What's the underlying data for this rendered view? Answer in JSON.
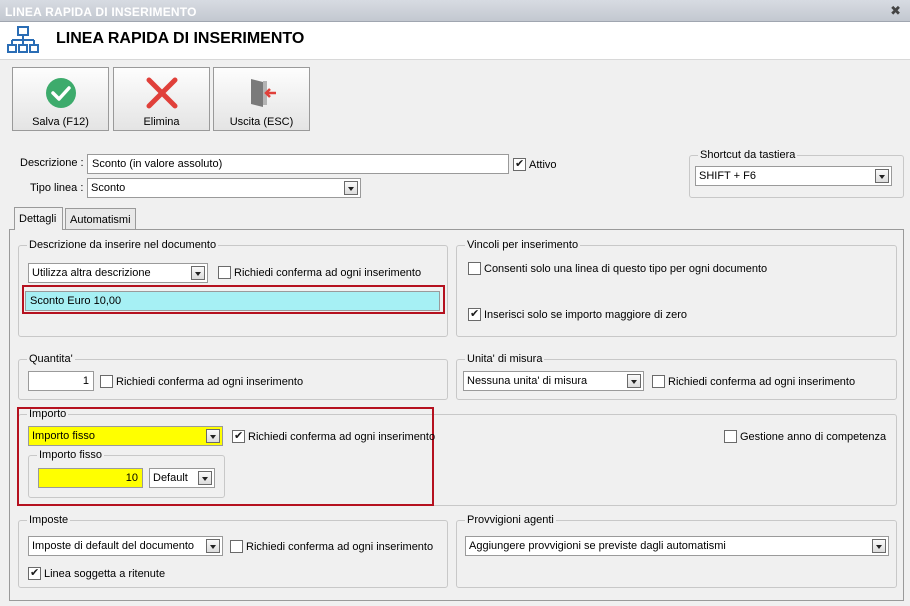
{
  "window": {
    "title": "LINEA RAPIDA DI INSERIMENTO",
    "header_title": "LINEA RAPIDA DI INSERIMENTO"
  },
  "toolbar": {
    "save_label": "Salva (F12)",
    "delete_label": "Elimina",
    "exit_label": "Uscita (ESC)"
  },
  "form": {
    "descrizione_label": "Descrizione :",
    "descrizione_value": "Sconto (in valore assoluto)",
    "attivo_label": "Attivo",
    "tipo_linea_label": "Tipo linea :",
    "tipo_linea_value": "Sconto"
  },
  "shortcut": {
    "title": "Shortcut da tastiera",
    "value": "SHIFT + F6"
  },
  "tabs": [
    {
      "label": "Dettagli"
    },
    {
      "label": "Automatismi"
    }
  ],
  "descrizione_doc": {
    "title": "Descrizione da inserire nel documento",
    "combo_value": "Utilizza altra descrizione",
    "confirm_label": "Richiedi conferma ad ogni inserimento",
    "text_value": "Sconto Euro 10,00"
  },
  "vincoli": {
    "title": "Vincoli per inserimento",
    "one_line_label": "Consenti solo una linea di questo tipo per ogni documento",
    "positive_label": "Inserisci solo se importo maggiore di zero"
  },
  "quantita": {
    "title": "Quantita'",
    "value": "1",
    "confirm_label": "Richiedi conferma ad ogni inserimento"
  },
  "unita": {
    "title": "Unita' di misura",
    "combo_value": "Nessuna unita' di misura",
    "confirm_label": "Richiedi conferma ad ogni inserimento"
  },
  "importo": {
    "title": "Importo",
    "combo_value": "Importo fisso",
    "confirm_label": "Richiedi conferma ad ogni inserimento",
    "competenza_label": "Gestione anno di competenza",
    "fisso_title": "Importo fisso",
    "fisso_value": "10",
    "fisso_mode": "Default"
  },
  "imposte": {
    "title": "Imposte",
    "combo_value": "Imposte di default del documento",
    "confirm_label": "Richiedi conferma ad ogni inserimento",
    "ritenute_label": "Linea soggetta a ritenute"
  },
  "provvigioni": {
    "title": "Provvigioni agenti",
    "combo_value": "Aggiungere provvigioni se previste dagli automatismi"
  },
  "colors": {
    "red_highlight": "#b5111f",
    "yellow_field": "#ffff00",
    "cyan_field": "#a6f0f4",
    "save_green": "#3dab6c",
    "delete_red": "#e0403a"
  }
}
